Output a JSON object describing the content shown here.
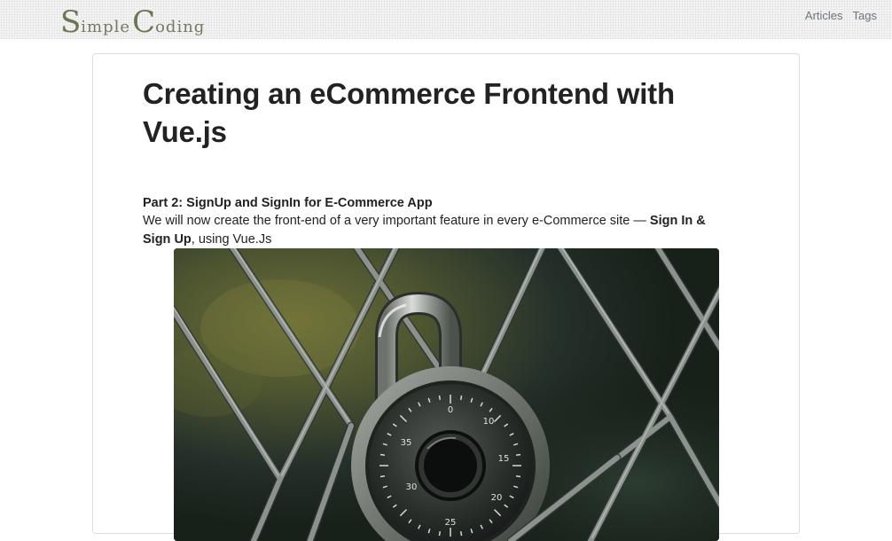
{
  "header": {
    "logo": {
      "letter1": "S",
      "word1": "imple",
      "letter2": "C",
      "word2": "oding"
    },
    "nav": [
      {
        "label": "Articles"
      },
      {
        "label": "Tags"
      }
    ]
  },
  "article": {
    "title": "Creating an eCommerce Frontend with Vue.js",
    "subtitle": "Part 2: SignUp and SignIn for E-Commerce App",
    "intro_before": "We will now create the front-end of a very important feature in every e-Commerce site — ",
    "intro_bold": "Sign In & Sign Up",
    "intro_after": ", using Vue.Js",
    "hero_image": "padlock on chain-link fence",
    "dial_numbers": [
      "0",
      "10",
      "15",
      "20",
      "25",
      "30",
      "35"
    ]
  },
  "colors": {
    "logo": "#6a7751",
    "nav": "#6c757d",
    "title": "#222222",
    "card_border": "#dcdcdc"
  }
}
